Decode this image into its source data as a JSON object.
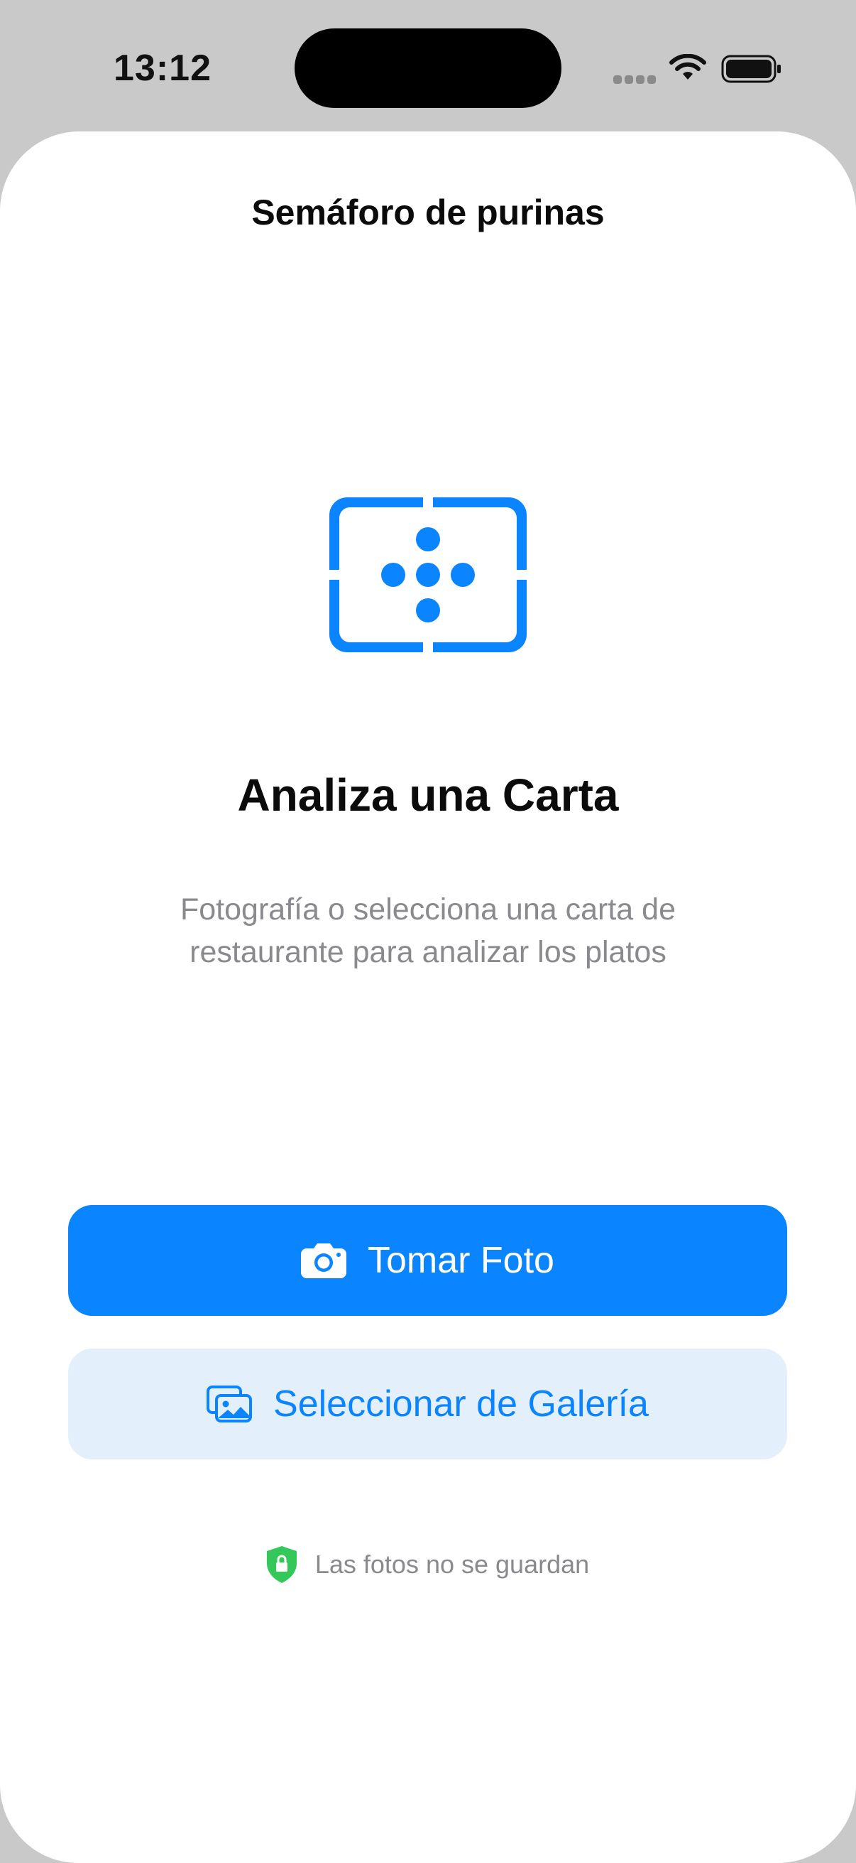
{
  "status_bar": {
    "time": "13:12"
  },
  "nav": {
    "title": "Semáforo de purinas"
  },
  "hero": {
    "icon": "viewfinder-dots-icon",
    "headline": "Analiza una Carta",
    "subtitle_line1": "Fotografía o selecciona una carta de",
    "subtitle_line2": "restaurante para analizar los platos"
  },
  "actions": {
    "take_photo": {
      "label": "Tomar Foto",
      "icon": "camera-icon"
    },
    "select_gallery": {
      "label": "Seleccionar de Galería",
      "icon": "photo-stack-icon"
    }
  },
  "privacy": {
    "label": "Las fotos no se guardan",
    "icon": "lock-shield-icon"
  },
  "colors": {
    "accent": "#0a84ff",
    "secondary_button_bg": "#e3f0fc",
    "secure_green": "#34c759",
    "muted_text": "#8a8a8e"
  }
}
